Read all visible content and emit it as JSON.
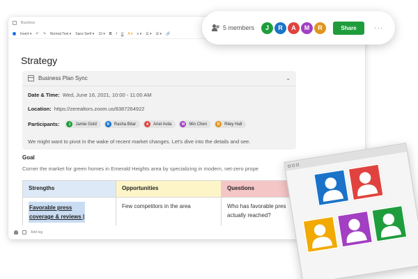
{
  "doc_path": "Business",
  "toolbar": {
    "items": [
      "Insert ▾",
      "↶",
      "↷",
      "Normal Text ▾",
      "Sans Serif ▾",
      "10 ▾",
      "B",
      "I",
      "U",
      "A ▾",
      "≡ ▾",
      "☰ ▾",
      "☰ ▾",
      "🔗"
    ]
  },
  "page_title": "Strategy",
  "meeting": {
    "title": "Business Plan Sync",
    "date_label": "Date & Time:",
    "date_value": "Wed, June 16, 2021, 10:00 - 11:00 AM",
    "location_label": "Location:",
    "location_value": "https://zerealtors.zoom.us/8387264922",
    "participants_label": "Participants:",
    "participants": [
      {
        "initial": "J",
        "name": "Jamie Gold",
        "color": "#1f9d3c"
      },
      {
        "initial": "R",
        "name": "Rasha Bitar",
        "color": "#1a73c8"
      },
      {
        "initial": "A",
        "name": "Ariel Avila",
        "color": "#e0433f"
      },
      {
        "initial": "M",
        "name": "Min Chen",
        "color": "#a23fc2"
      },
      {
        "initial": "R",
        "name": "Riley Hall",
        "color": "#e0951e"
      }
    ],
    "note": "We might want to pivot in the wake of recent market changes. Let's dive into the details and see."
  },
  "goal": {
    "heading": "Goal",
    "text": "Corner the market for green homes in Emerald Heights area by specializing in modern, net-zero prope"
  },
  "table": {
    "headers": [
      "Strengths",
      "Opportunities",
      "Questions"
    ],
    "row": {
      "strength_line1": "Favorable press",
      "strength_line2": "coverage & reviews |",
      "opportunity": "Few competitors in the area",
      "question_line1": "Who has favorable pres",
      "question_line2": "actually reached?"
    }
  },
  "footer": {
    "add_tag": "Add tag"
  },
  "share_bar": {
    "members_label": "5 members",
    "avatars": [
      {
        "initial": "J",
        "color": "#1f9d3c"
      },
      {
        "initial": "R",
        "color": "#1a73c8"
      },
      {
        "initial": "A",
        "color": "#e0433f"
      },
      {
        "initial": "M",
        "color": "#a23fc2"
      },
      {
        "initial": "R",
        "color": "#e0951e"
      }
    ],
    "share_label": "Share",
    "more_label": "···"
  },
  "video_tiles": [
    {
      "color": "#1a73c8"
    },
    {
      "color": "#e0433f"
    },
    {
      "color": "#f2a900"
    },
    {
      "color": "#a23fc2"
    },
    {
      "color": "#1f9d3c"
    }
  ]
}
